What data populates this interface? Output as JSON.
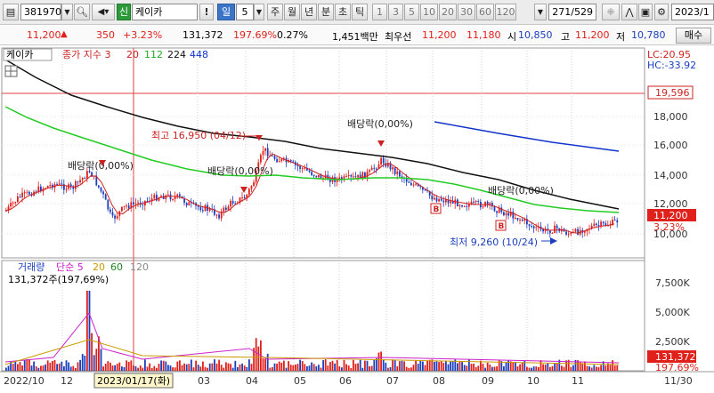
{
  "toolbar": {
    "code": "381970",
    "code_dropdown_icon": "chevron-down-icon",
    "search_icon": "search-icon",
    "speaker_icon": "speaker-icon",
    "new_badge": "신",
    "stock_name": "케이카",
    "alert_label": "!",
    "period_selected": "일",
    "period_count": "5",
    "period_options": [
      "주",
      "월",
      "년",
      "분",
      "초",
      "틱"
    ],
    "interval_options": [
      "1",
      "3",
      "5",
      "10",
      "20",
      "30",
      "60",
      "120"
    ],
    "page_counter": "271/529",
    "date_field": "2023/1"
  },
  "quote": {
    "price": "11,200",
    "arrow": "▲",
    "change": "350",
    "change_pct": "+3.23%",
    "volume": "131,372",
    "volume_ratio": "197.69%",
    "turnover": "0.27%",
    "amount": "1,451백만",
    "best_ask_label": "최우선",
    "best_ask": "11,200",
    "best_bid": "11,180",
    "open_label": "시",
    "open": "10,850",
    "high_label": "고",
    "high": "11,200",
    "low_label": "저",
    "low": "10,780",
    "buy_button": "매수"
  },
  "price_pane": {
    "title": "케이카",
    "indicator_label": "종가 지수 3",
    "ma_values": [
      "20",
      "112",
      "224",
      "448"
    ],
    "lc_label": "LC:20.95",
    "hc_label": "HC:-33.92",
    "ref_price_label": "19,596",
    "current_price_label": "11,200",
    "current_pct_label": "3.23%",
    "y_ticks": [
      "18,000",
      "16,000",
      "14,000",
      "12,000",
      "10,000"
    ],
    "annotations": {
      "high": "최고 16,950 (04/12)",
      "low": "최저 9,260 (10/24)",
      "div1": "배당락(0,00%)",
      "div2": "배당락(0,00%)",
      "div3": "배당락(0,00%)",
      "div4": "배당락(0,00%)"
    },
    "b_markers": [
      "B",
      "B"
    ]
  },
  "volume_pane": {
    "title": "거래량",
    "ma_label": "단순 5",
    "ma_values": [
      "20",
      "60",
      "120"
    ],
    "value_label": "131,372주(197,69%)",
    "y_ticks": [
      "7,500K",
      "5,000K",
      "2,500K"
    ],
    "current_label": "131,372",
    "current_pct": "197.69%"
  },
  "x_axis": {
    "labels": [
      "2022/10",
      "12",
      "03",
      "04",
      "05",
      "06",
      "07",
      "08",
      "09",
      "10",
      "11",
      "11/30"
    ],
    "cursor_label": "2023/01/17(화)"
  },
  "colors": {
    "up": "#e0201a",
    "down": "#1b3fbf",
    "ma20": "#cc2222",
    "ma112": "#22cc22",
    "ma224": "#111111",
    "ma448": "#1133cc"
  }
}
